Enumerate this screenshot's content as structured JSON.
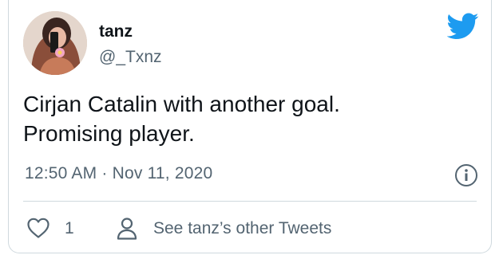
{
  "tweet": {
    "author_name": "tanz",
    "author_handle": "@_Txnz",
    "text_line_1": "Cirjan Catalin with another goal.",
    "text_line_2": "Promising player.",
    "timestamp": "12:50 AM · Nov 11, 2020",
    "like_count": "1",
    "other_tweets_label": "See tanz’s other Tweets"
  },
  "icons": {
    "brand": "twitter-bird-icon",
    "info": "info-icon",
    "like": "heart-icon",
    "profile": "person-icon"
  },
  "colors": {
    "brand_blue": "#1d9bf0",
    "text_primary": "#0f1419",
    "text_secondary": "#536471",
    "border": "#cfd9de"
  }
}
